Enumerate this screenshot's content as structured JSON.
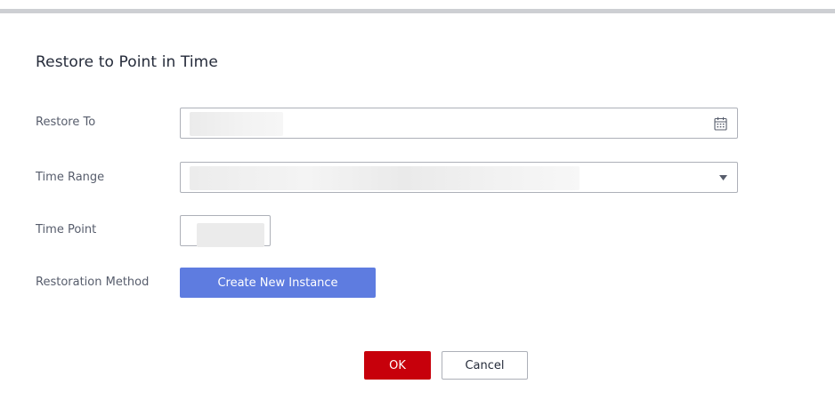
{
  "dialog": {
    "title": "Restore to Point in Time"
  },
  "form": {
    "restore_to": {
      "label": "Restore To",
      "icon": "calendar-icon"
    },
    "time_range": {
      "label": "Time Range",
      "icon": "chevron-down-icon"
    },
    "time_point": {
      "label": "Time Point"
    },
    "restoration_method": {
      "label": "Restoration Method",
      "button_label": "Create New Instance"
    }
  },
  "footer": {
    "ok_label": "OK",
    "cancel_label": "Cancel"
  },
  "colors": {
    "primary": "#5e7ce0",
    "confirm": "#c7000b",
    "border": "#adb0b8",
    "label_text": "#575d6c"
  }
}
